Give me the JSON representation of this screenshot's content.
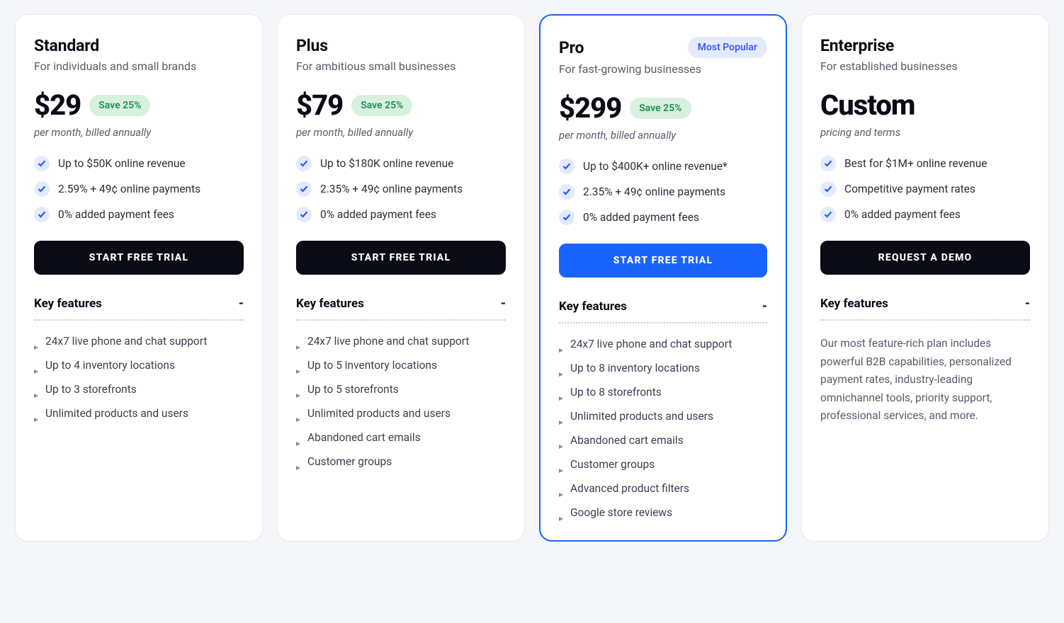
{
  "common": {
    "key_features_label": "Key features",
    "collapse_symbol": "-"
  },
  "plans": [
    {
      "id": "standard",
      "title": "Standard",
      "subtitle": "For individuals and small brands",
      "price": "$29",
      "save_badge": "Save 25%",
      "billing": "per month, billed annually",
      "highlights": [
        "Up to $50K online revenue",
        "2.59% + 49¢ online payments",
        "0% added payment fees"
      ],
      "cta": "START FREE TRIAL",
      "cta_style": "dark",
      "featured": false,
      "features": [
        "24x7 live phone and chat support",
        "Up to 4 inventory locations",
        "Up to 3 storefronts",
        "Unlimited products and users"
      ]
    },
    {
      "id": "plus",
      "title": "Plus",
      "subtitle": "For ambitious small businesses",
      "price": "$79",
      "save_badge": "Save 25%",
      "billing": "per month, billed annually",
      "highlights": [
        "Up to $180K online revenue",
        "2.35% + 49¢ online payments",
        "0% added payment fees"
      ],
      "cta": "START FREE TRIAL",
      "cta_style": "dark",
      "featured": false,
      "features": [
        "24x7 live phone and chat support",
        "Up to 5 inventory locations",
        "Up to 5 storefronts",
        "Unlimited products and users",
        "Abandoned cart emails",
        "Customer groups"
      ]
    },
    {
      "id": "pro",
      "title": "Pro",
      "badge": "Most Popular",
      "subtitle": "For fast-growing businesses",
      "price": "$299",
      "save_badge": "Save 25%",
      "billing": "per month, billed annually",
      "highlights": [
        "Up to $400K+ online revenue*",
        "2.35% + 49¢ online payments",
        "0% added payment fees"
      ],
      "cta": "START FREE TRIAL",
      "cta_style": "primary",
      "featured": true,
      "features": [
        "24x7 live phone and chat support",
        "Up to 8 inventory locations",
        "Up to 8 storefronts",
        "Unlimited products and users",
        "Abandoned cart emails",
        "Customer groups",
        "Advanced product filters",
        "Google store reviews"
      ]
    },
    {
      "id": "enterprise",
      "title": "Enterprise",
      "subtitle": "For established businesses",
      "price_custom": "Custom",
      "billing": "pricing and terms",
      "highlights": [
        "Best for $1M+ online revenue",
        "Competitive payment rates",
        "0% added payment fees"
      ],
      "cta": "REQUEST A DEMO",
      "cta_style": "dark",
      "featured": false,
      "features_text": "Our most feature-rich plan includes powerful B2B capabilities, personalized payment rates, industry-leading omnichannel tools, priority support, professional services, and more."
    }
  ]
}
